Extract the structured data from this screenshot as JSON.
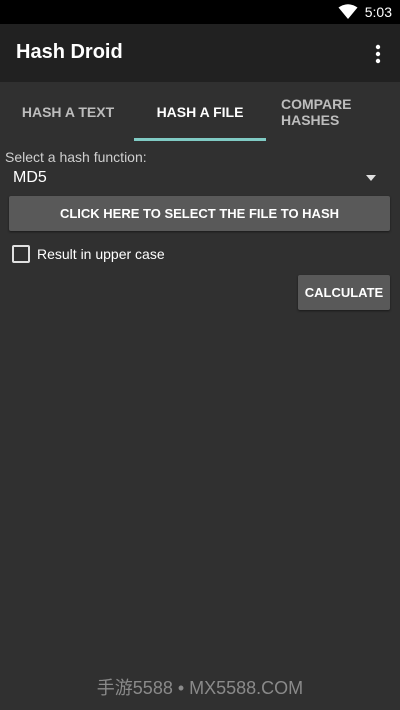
{
  "status_bar": {
    "time": "5:03",
    "wifi_icon": "wifi-icon"
  },
  "app_bar": {
    "title": "Hash Droid",
    "menu_icon": "more-vert-icon"
  },
  "tabs": [
    {
      "label": "HASH A TEXT",
      "active": false
    },
    {
      "label": "HASH A FILE",
      "active": true
    },
    {
      "label": "COMPARE HASHES",
      "active": false
    }
  ],
  "colors": {
    "tab_indicator": "#80cbc4",
    "background": "#303030",
    "app_bar": "#212121",
    "button": "#595959"
  },
  "form": {
    "hash_function_label": "Select a hash function:",
    "hash_function_value": "MD5",
    "select_file_button": "CLICK HERE TO SELECT THE FILE TO HASH",
    "uppercase_label": "Result in upper case",
    "uppercase_checked": false,
    "calculate_button": "CALCULATE"
  },
  "watermark": "手游5588 • MX5588.COM"
}
